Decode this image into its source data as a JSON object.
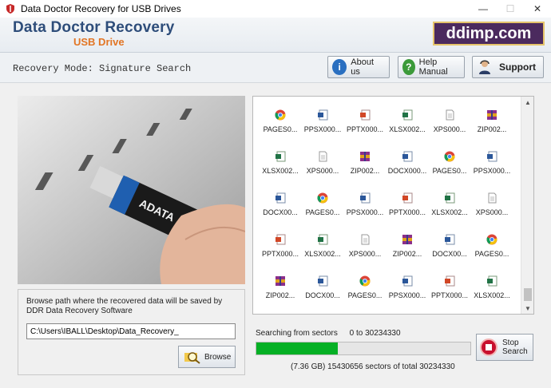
{
  "window": {
    "title": "Data Doctor Recovery for USB Drives",
    "min": "—",
    "max": "☐",
    "close": "✕"
  },
  "banner": {
    "title": "Data Doctor Recovery",
    "subtitle": "USB Drive",
    "brand": "ddimp.com"
  },
  "toolbar": {
    "mode_text": "Recovery Mode: Signature Search",
    "about_label": "About us",
    "help_label": "Help Manual",
    "support_label": "Support"
  },
  "photo": {
    "drive_label": "ADATA"
  },
  "left_panel": {
    "hint": "Browse path where the recovered data will be saved by DDR Data Recovery Software",
    "path_value": "C:\\Users\\IBALL\\Desktop\\Data_Recovery_",
    "browse_label": "Browse"
  },
  "files": [
    {
      "type": "chrome",
      "label": "PAGES0..."
    },
    {
      "type": "ppsx",
      "label": "PPSX000..."
    },
    {
      "type": "pptx",
      "label": "PPTX000..."
    },
    {
      "type": "xlsx",
      "label": "XLSX002..."
    },
    {
      "type": "xps",
      "label": "XPS000..."
    },
    {
      "type": "zip",
      "label": "ZIP002..."
    },
    {
      "type": "xlsx",
      "label": "XLSX002..."
    },
    {
      "type": "xps",
      "label": "XPS000..."
    },
    {
      "type": "zip",
      "label": "ZIP002..."
    },
    {
      "type": "docx",
      "label": "DOCX000..."
    },
    {
      "type": "chrome",
      "label": "PAGES0..."
    },
    {
      "type": "ppsx",
      "label": "PPSX000..."
    },
    {
      "type": "docx",
      "label": "DOCX00..."
    },
    {
      "type": "chrome",
      "label": "PAGES0..."
    },
    {
      "type": "ppsx",
      "label": "PPSX000..."
    },
    {
      "type": "pptx",
      "label": "PPTX000..."
    },
    {
      "type": "xlsx",
      "label": "XLSX002..."
    },
    {
      "type": "xps",
      "label": "XPS000..."
    },
    {
      "type": "pptx",
      "label": "PPTX000..."
    },
    {
      "type": "xlsx",
      "label": "XLSX002..."
    },
    {
      "type": "xps",
      "label": "XPS000..."
    },
    {
      "type": "zip",
      "label": "ZIP002..."
    },
    {
      "type": "docx",
      "label": "DOCX00..."
    },
    {
      "type": "chrome",
      "label": "PAGES0..."
    },
    {
      "type": "zip",
      "label": "ZIP002..."
    },
    {
      "type": "docx",
      "label": "DOCX00..."
    },
    {
      "type": "chrome",
      "label": "PAGES0..."
    },
    {
      "type": "ppsx",
      "label": "PPSX000..."
    },
    {
      "type": "pptx",
      "label": "PPTX000..."
    },
    {
      "type": "xlsx",
      "label": "XLSX002..."
    }
  ],
  "progress": {
    "searching_label": "Searching from sectors",
    "range_text": "0 to 30234330",
    "fraction": 0.38,
    "sectors_text": "(7.36 GB) 15430656  sectors  of  total 30234330",
    "stop_label": "Stop Search"
  },
  "colors": {
    "progress": "#06b025",
    "banner_title": "#2e4d7a",
    "banner_sub": "#e27524",
    "brand_bg": "#4b2a5e"
  }
}
